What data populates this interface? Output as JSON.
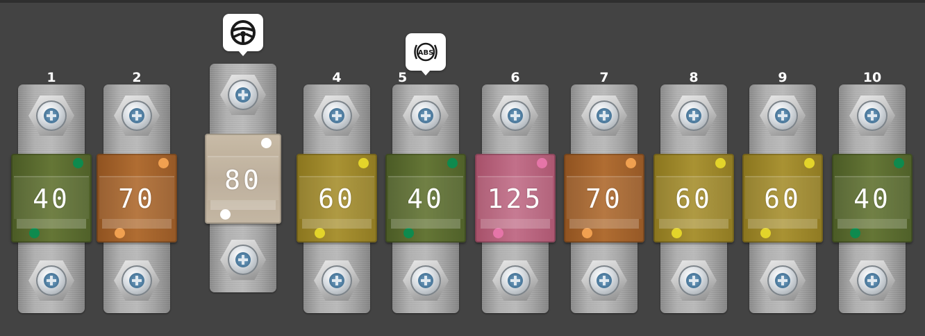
{
  "fuses": [
    {
      "number": "1",
      "rating": "40",
      "color": "#5a6b2f",
      "dot_color": "#0e8a4e"
    },
    {
      "number": "2",
      "rating": "70",
      "color": "#a0612a",
      "dot_color": "#f0a050"
    },
    {
      "number": "3",
      "rating": "80",
      "color": "#c2b4a0",
      "dot_color": "#ffffff",
      "icon": "steering-wheel-icon"
    },
    {
      "number": "4",
      "rating": "60",
      "color": "#9d8627",
      "dot_color": "#e3d42a"
    },
    {
      "number": "5",
      "rating": "40",
      "color": "#5a6b2f",
      "dot_color": "#0e8a4e",
      "icon": "abs-icon",
      "icon_text": "ABS"
    },
    {
      "number": "6",
      "rating": "125",
      "color": "#b75f7a",
      "dot_color": "#e575a8"
    },
    {
      "number": "7",
      "rating": "70",
      "color": "#a0612a",
      "dot_color": "#f0a050"
    },
    {
      "number": "8",
      "rating": "60",
      "color": "#9d8627",
      "dot_color": "#e3d42a"
    },
    {
      "number": "9",
      "rating": "60",
      "color": "#9d8627",
      "dot_color": "#e3d42a"
    },
    {
      "number": "10",
      "rating": "40",
      "color": "#5a6b2f",
      "dot_color": "#0e8a4e"
    }
  ]
}
